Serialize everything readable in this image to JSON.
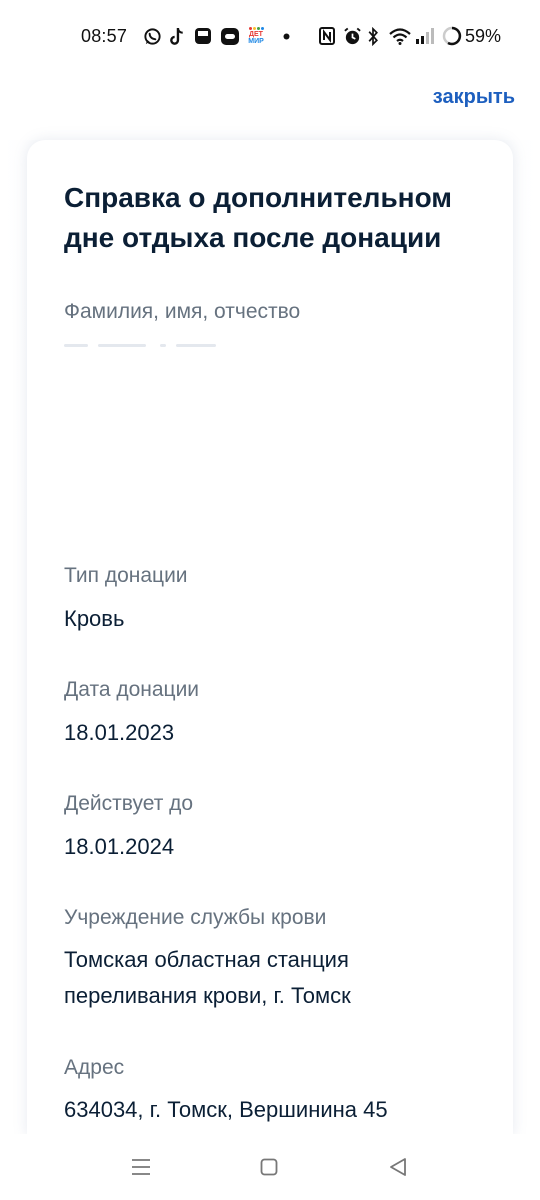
{
  "status_bar": {
    "time": "08:57",
    "battery": "59%",
    "icons": [
      "whatsapp-icon",
      "tiktok-icon",
      "cup-icon",
      "app-icon",
      "detmir-icon",
      "dot-icon",
      "nfc-icon",
      "alarm-icon",
      "bluetooth-icon",
      "wifi-icon",
      "signal-icon",
      "battery-icon"
    ],
    "detmir_top": "ДЕТ",
    "detmir_bottom": "МИР"
  },
  "header": {
    "close_label": "закрыть"
  },
  "card": {
    "title": "Справка о дополнительном дне отдыха после донации",
    "fields": [
      {
        "label": "Фамилия, имя, отчество",
        "value": ""
      },
      {
        "label": "Тип донации",
        "value": "Кровь"
      },
      {
        "label": "Дата донации",
        "value": "18.01.2023"
      },
      {
        "label": "Действует до",
        "value": "18.01.2024"
      },
      {
        "label": "Учреждение службы крови",
        "value": "Томская областная станция переливания крови, г. Томск"
      },
      {
        "label": "Адрес",
        "value": "634034, г. Томск, Вершинина 45"
      }
    ]
  },
  "nav_bar": {
    "icons": [
      "menu-icon",
      "home-icon",
      "back-icon"
    ]
  },
  "colors": {
    "accent": "#1d5fbf",
    "text": "#0b1f35",
    "muted": "#66727f"
  }
}
